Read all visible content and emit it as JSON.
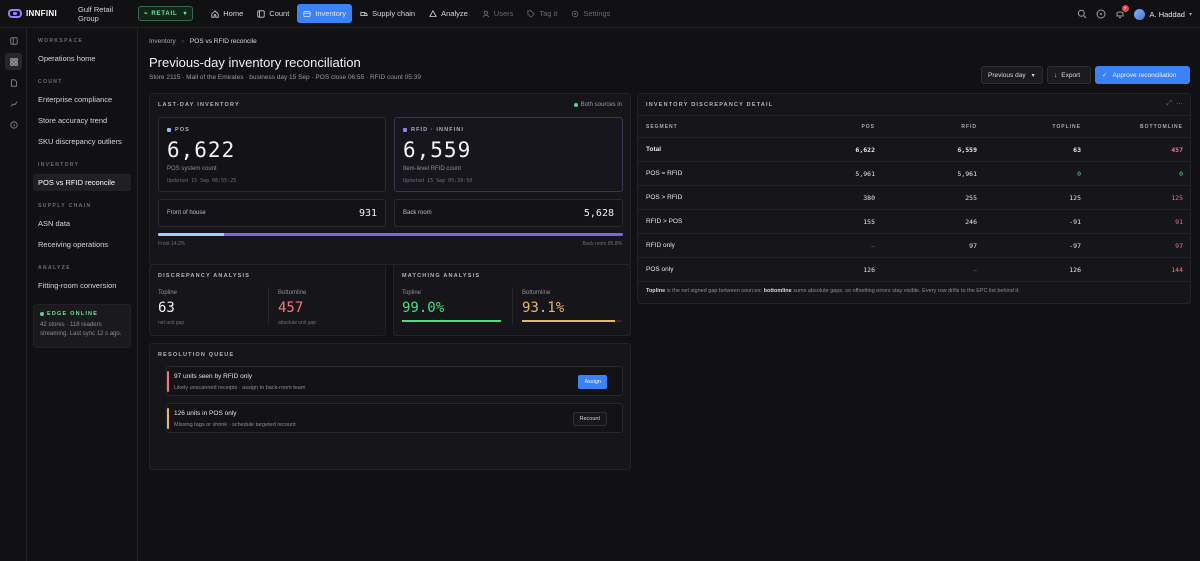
{
  "topbar": {
    "brand": "INNFINI",
    "org": "Gulf Retail Group",
    "mode": "RETAIL",
    "nav": [
      {
        "label": "Home",
        "icon": "home-icon"
      },
      {
        "label": "Count",
        "icon": "count-icon"
      },
      {
        "label": "Inventory",
        "icon": "inventory-icon"
      },
      {
        "label": "Supply chain",
        "icon": "truck-icon"
      },
      {
        "label": "Analyze",
        "icon": "analyze-icon"
      },
      {
        "label": "Users",
        "icon": "users-icon"
      },
      {
        "label": "Tag it",
        "icon": "tag-icon"
      },
      {
        "label": "Settings",
        "icon": "settings-icon"
      }
    ],
    "notifications": "7",
    "user": "A. Haddad"
  },
  "sidebar": {
    "sections": {
      "workspace": "WORKSPACE",
      "count": "COUNT",
      "inventory": "INVENTORY",
      "supply": "SUPPLY CHAIN",
      "analyze": "ANALYZE"
    },
    "items": {
      "ops": "Operations home",
      "compliance": "Enterprise compliance",
      "accuracy": "Store accuracy trend",
      "sku": "SKU discrepancy outliers",
      "posrfid": "POS vs RFID reconcile",
      "asn": "ASN data",
      "receiving": "Receiving operations",
      "fitting": "Fitting-room conversion"
    },
    "edge": {
      "title": "EDGE ONLINE",
      "desc": "42 stores · 118 readers streaming. Last sync 12 s ago."
    }
  },
  "page": {
    "crumb_parent": "Inventory",
    "crumb_current": "POS vs RFID reconcile",
    "title": "Previous-day inventory reconciliation",
    "subtitle": "Store 2115 · Mall of the Emirates · business day 15 Sep · POS close 06:55 · RFID count 05:39",
    "prev_day": "Previous day",
    "export": "Export",
    "approve": "Approve reconciliation"
  },
  "last_day": {
    "title": "LAST-DAY INVENTORY",
    "status": "Both sources in",
    "pos": {
      "label": "POS",
      "value": "6,622",
      "desc": "POS system count",
      "updated": "Updated 15 Sep 06:55:25"
    },
    "rfid": {
      "label": "RFID · INNFINI",
      "value": "6,559",
      "desc": "Item-level RFID count",
      "updated": "Updated 15 Sep 05:39:50"
    },
    "front_label": "Front of house",
    "front_value": "931",
    "back_label": "Back room",
    "back_value": "5,628",
    "front_pct_label": "Front 14.2%",
    "back_pct_label": "Back room 85.8%",
    "front_fraction": 0.142
  },
  "discrepancy": {
    "title": "DISCREPANCY ANALYSIS",
    "topline_label": "Topline",
    "topline_value": "63",
    "topline_desc": "net unit gap",
    "bottomline_label": "Bottomline",
    "bottomline_value": "457",
    "bottomline_desc": "absolute unit gap"
  },
  "matching": {
    "title": "MATCHING ANALYSIS",
    "topline_label": "Topline",
    "topline_value": "99.0%",
    "bottomline_label": "Bottomline",
    "bottomline_value": "93.1%",
    "topline_fraction": 0.99,
    "bottomline_fraction": 0.931
  },
  "queue": {
    "title": "RESOLUTION QUEUE",
    "items": [
      {
        "title": "97 units seen by RFID only",
        "desc": "Likely unscanned receipts · assign to back-room team",
        "action": "Assign"
      },
      {
        "title": "126 units in POS only",
        "desc": "Missing tags or shrink · schedule targeted recount",
        "action": "Recount"
      }
    ]
  },
  "detail": {
    "title": "INVENTORY DISCREPANCY DETAIL",
    "headers": [
      "SEGMENT",
      "POS",
      "RFID",
      "TOPLINE",
      "BOTTOMLINE"
    ],
    "rows": [
      [
        "Total",
        "6,622",
        "6,559",
        "63",
        "457"
      ],
      [
        "POS = RFID",
        "5,961",
        "5,961",
        "0",
        "0"
      ],
      [
        "POS > RFID",
        "380",
        "255",
        "125",
        "125"
      ],
      [
        "RFID > POS",
        "155",
        "246",
        "-91",
        "91"
      ],
      [
        "RFID only",
        "—",
        "97",
        "-97",
        "97"
      ],
      [
        "POS only",
        "126",
        "—",
        "126",
        "144"
      ]
    ],
    "footnote_b1": "Topline",
    "footnote_t1": " is the net signed gap between sources; ",
    "footnote_b2": "bottomline",
    "footnote_t2": " sums absolute gaps, so offsetting errors stay visible. Every row drills to the EPC list behind it."
  },
  "colors": {
    "accent": "#3b82f6",
    "green": "#4ade80",
    "red": "#f87183",
    "gold": "#e8b56a",
    "pos": "#9ab8ff",
    "rfid": "#9b7cf5"
  }
}
